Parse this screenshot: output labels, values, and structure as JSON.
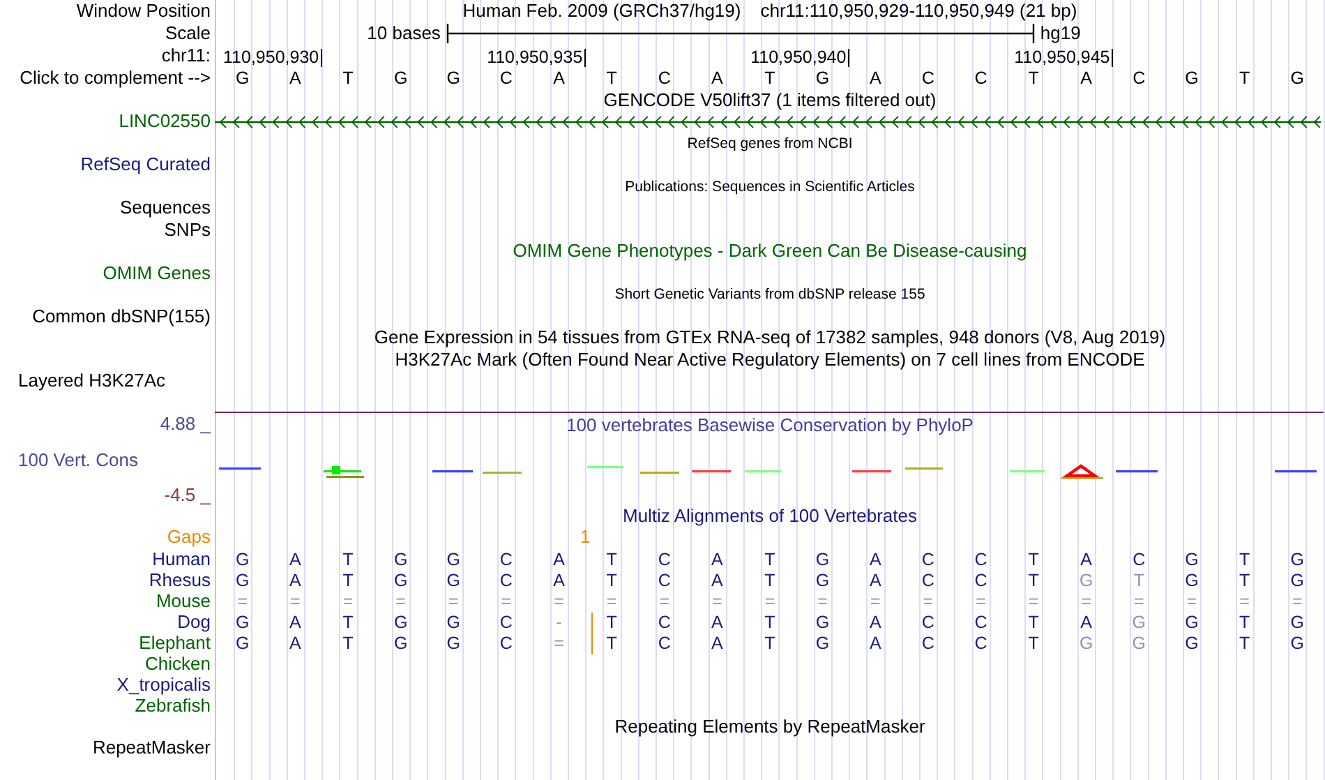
{
  "header": {
    "label": "Window Position",
    "assembly": "Human Feb. 2009 (GRCh37/hg19)",
    "position": "chr11:110,950,929-110,950,949 (21 bp)"
  },
  "scale": {
    "label": "Scale",
    "length": "10 bases",
    "assembly": "hg19"
  },
  "ruler": {
    "label": "chr11:",
    "ticks": [
      "110,950,930",
      "110,950,935",
      "110,950,940",
      "110,950,945"
    ]
  },
  "complement": {
    "label": "Click to complement -->",
    "bases": [
      "G",
      "A",
      "T",
      "G",
      "G",
      "C",
      "A",
      "T",
      "C",
      "A",
      "T",
      "G",
      "A",
      "C",
      "C",
      "T",
      "A",
      "C",
      "G",
      "T",
      "G"
    ]
  },
  "tracks": [
    {
      "kind": "title",
      "text": "GENCODE V50lift37 (1 items filtered out)",
      "color": "#000000"
    },
    {
      "kind": "gene",
      "label": "LINC02550",
      "color": "#006400"
    },
    {
      "kind": "subtitle",
      "text": "RefSeq genes from NCBI",
      "color": "#000000"
    },
    {
      "kind": "label",
      "label": "RefSeq Curated",
      "color": "#1a1a80"
    },
    {
      "kind": "subtitle",
      "text": "Publications: Sequences in Scientific Articles",
      "color": "#000000"
    },
    {
      "kind": "label",
      "label": "Sequences",
      "color": "#000000"
    },
    {
      "kind": "label",
      "label": "SNPs",
      "color": "#000000"
    },
    {
      "kind": "title",
      "text": "OMIM Gene Phenotypes - Dark Green Can Be Disease-causing",
      "color": "#006400"
    },
    {
      "kind": "label",
      "label": "OMIM Genes",
      "color": "#006400"
    },
    {
      "kind": "subtitle",
      "text": "Short Genetic Variants from dbSNP release 155",
      "color": "#000000"
    },
    {
      "kind": "label",
      "label": "Common dbSNP(155)",
      "color": "#000000"
    },
    {
      "kind": "title",
      "text": "Gene Expression in 54 tissues from GTEx RNA-seq of 17382 samples, 948 donors (V8, Aug 2019)",
      "color": "#000000"
    },
    {
      "kind": "title",
      "text": "H3K27Ac Mark (Often Found Near Active Regulatory Elements) on 7 cell lines from ENCODE",
      "color": "#000000"
    },
    {
      "kind": "composite",
      "label": "Layered H3K27Ac",
      "color": "#000000"
    },
    {
      "kind": "divider"
    },
    {
      "kind": "wiggle",
      "label": "100 Vert. Cons",
      "title": "100 vertebrates Basewise Conservation by PhyloP",
      "max": "4.88 _",
      "min": "-4.5 _"
    },
    {
      "kind": "alignment",
      "title": "Multiz Alignments of 100 Vertebrates",
      "gaps": {
        "label": "Gaps",
        "count": "1"
      },
      "species": [
        {
          "name": "Human",
          "color": "#1a1a80",
          "bases": [
            "G",
            "A",
            "T",
            "G",
            "G",
            "C",
            "A",
            "T",
            "C",
            "A",
            "T",
            "G",
            "A",
            "C",
            "C",
            "T",
            "A",
            "C",
            "G",
            "T",
            "G"
          ]
        },
        {
          "name": "Rhesus",
          "color": "#1a1a80",
          "bases": [
            "G",
            "A",
            "T",
            "G",
            "G",
            "C",
            "A",
            "T",
            "C",
            "A",
            "T",
            "G",
            "A",
            "C",
            "C",
            "T",
            {
              "base": "G",
              "faded": true
            },
            {
              "base": "T",
              "faded": true
            },
            "G",
            "T",
            "G"
          ]
        },
        {
          "name": "Mouse",
          "color": "#006400",
          "bases": [
            {
              "base": "=",
              "faded": true
            },
            {
              "base": "=",
              "faded": true
            },
            {
              "base": "=",
              "faded": true
            },
            {
              "base": "=",
              "faded": true
            },
            {
              "base": "=",
              "faded": true
            },
            {
              "base": "=",
              "faded": true
            },
            {
              "base": "=",
              "faded": true
            },
            {
              "base": "=",
              "faded": true
            },
            {
              "base": "=",
              "faded": true
            },
            {
              "base": "=",
              "faded": true
            },
            {
              "base": "=",
              "faded": true
            },
            {
              "base": "=",
              "faded": true
            },
            {
              "base": "=",
              "faded": true
            },
            {
              "base": "=",
              "faded": true
            },
            {
              "base": "=",
              "faded": true
            },
            {
              "base": "=",
              "faded": true
            },
            {
              "base": "=",
              "faded": true
            },
            {
              "base": "=",
              "faded": true
            },
            {
              "base": "=",
              "faded": true
            },
            {
              "base": "=",
              "faded": true
            },
            {
              "base": "=",
              "faded": true
            }
          ]
        },
        {
          "name": "Dog",
          "color": "#1a1a80",
          "bases": [
            "G",
            "A",
            "T",
            "G",
            "G",
            "C",
            {
              "base": "-",
              "faded": true
            },
            {
              "base": "T",
              "insertion": true
            },
            "C",
            "A",
            "T",
            "G",
            "A",
            "C",
            "C",
            "T",
            "A",
            {
              "base": "G",
              "faded": true
            },
            "G",
            "T",
            "G"
          ]
        },
        {
          "name": "Elephant",
          "color": "#006400",
          "bases": [
            "G",
            "A",
            "T",
            "G",
            "G",
            "C",
            {
              "base": "=",
              "faded": true
            },
            {
              "base": "T",
              "insertion": true
            },
            "C",
            "A",
            "T",
            "G",
            "A",
            "C",
            "C",
            "T",
            {
              "base": "G",
              "faded": true
            },
            {
              "base": "G",
              "faded": true
            },
            "G",
            "T",
            "G"
          ]
        },
        {
          "name": "Chicken",
          "color": "#006400"
        },
        {
          "name": "X_tropicalis",
          "color": "#1a1a80"
        },
        {
          "name": "Zebrafish",
          "color": "#006400"
        }
      ]
    },
    {
      "kind": "title",
      "text": "Repeating Elements by RepeatMasker",
      "color": "#000000"
    },
    {
      "kind": "label",
      "label": "RepeatMasker",
      "color": "#000000"
    }
  ]
}
